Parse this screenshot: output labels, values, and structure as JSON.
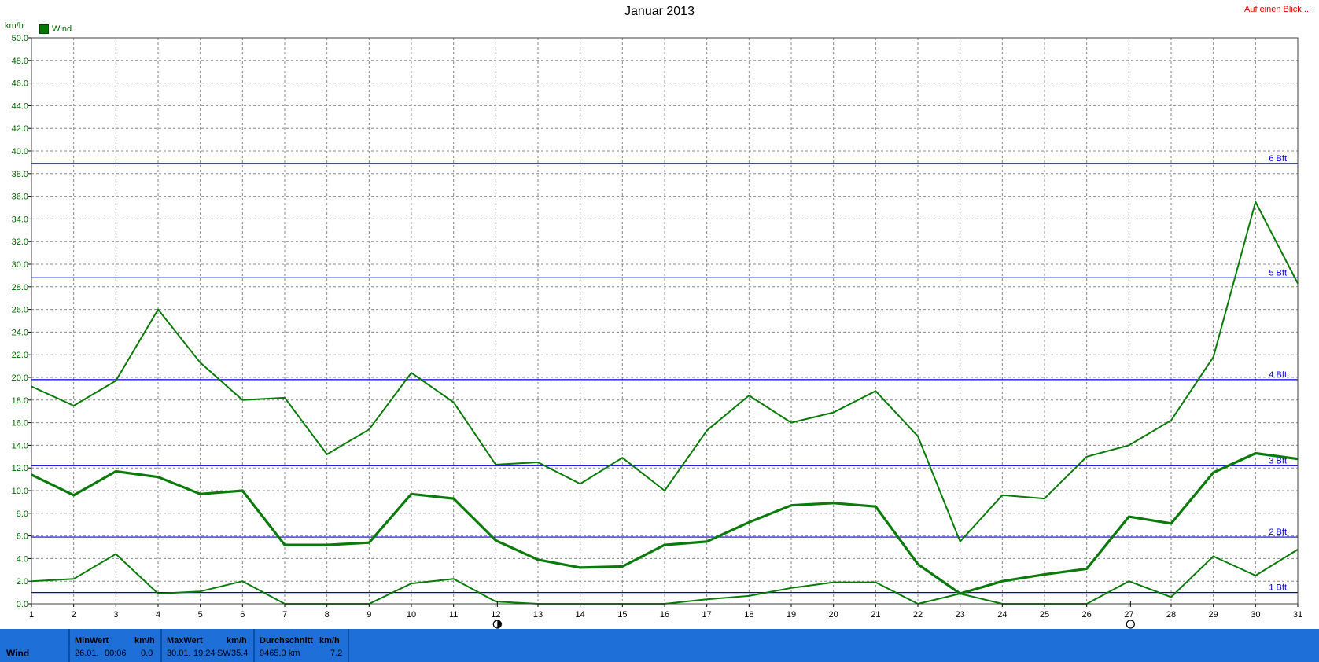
{
  "header": {
    "title": "Januar 2013",
    "glance_link": "Auf einen Blick ...",
    "unit": "km/h",
    "legend": "Wind"
  },
  "colors": {
    "series": "#0a7a0a",
    "beaufort": "#0000e0",
    "grid": "#8a8a8a",
    "stats_bar": "#1f6fd9"
  },
  "moon_icons": [
    "first-quarter-moon-icon",
    "full-moon-icon"
  ],
  "chart_data": {
    "type": "line",
    "title": "Januar 2013",
    "ylabel": "km/h",
    "ylim": [
      0,
      50
    ],
    "ytick_step": 2,
    "grid": true,
    "legend_position": "top-left",
    "x": [
      1,
      2,
      3,
      4,
      5,
      6,
      7,
      8,
      9,
      10,
      11,
      12,
      13,
      14,
      15,
      16,
      17,
      18,
      19,
      20,
      21,
      22,
      23,
      24,
      25,
      26,
      27,
      28,
      29,
      30,
      31
    ],
    "series": [
      {
        "name": "Wind",
        "role": "max",
        "values": [
          19.2,
          17.5,
          19.7,
          26.0,
          21.3,
          18.0,
          18.2,
          13.2,
          15.4,
          20.4,
          17.8,
          12.3,
          12.5,
          10.6,
          12.9,
          10.0,
          15.3,
          18.4,
          16.0,
          16.9,
          18.8,
          14.8,
          5.5,
          9.6,
          9.3,
          13.0,
          14.0,
          16.2,
          21.8,
          35.5,
          28.3
        ]
      },
      {
        "role": "average",
        "values": [
          11.4,
          9.6,
          11.7,
          11.2,
          9.7,
          10.0,
          5.2,
          5.2,
          5.4,
          9.7,
          9.3,
          5.6,
          3.9,
          3.2,
          3.3,
          5.2,
          5.5,
          7.2,
          8.7,
          8.9,
          8.6,
          3.5,
          0.9,
          2.0,
          2.6,
          3.1,
          7.7,
          7.1,
          11.6,
          13.3,
          12.8
        ]
      },
      {
        "role": "min",
        "values": [
          2.0,
          2.2,
          4.4,
          0.9,
          1.1,
          2.0,
          0.0,
          0.0,
          0.0,
          1.8,
          2.2,
          0.2,
          0.0,
          0.0,
          0.0,
          0.0,
          0.4,
          0.7,
          1.4,
          1.9,
          1.9,
          0.0,
          0.9,
          0.0,
          0.0,
          0.0,
          2.0,
          0.6,
          4.2,
          2.5,
          4.8
        ]
      }
    ],
    "reference_lines": [
      {
        "label": "1 Bft",
        "value": 1.0
      },
      {
        "label": "2 Bft",
        "value": 5.9
      },
      {
        "label": "3 Bft",
        "value": 12.2
      },
      {
        "label": "4 Bft",
        "value": 19.8
      },
      {
        "label": "5 Bft",
        "value": 28.8
      },
      {
        "label": "6 Bft",
        "value": 38.9
      }
    ],
    "moon_markers": [
      {
        "day": 12,
        "phase": "first-quarter"
      },
      {
        "day": 27,
        "phase": "full"
      }
    ]
  },
  "stats": {
    "series_name": "Wind",
    "min": {
      "header": "MinWert",
      "unit": "km/h",
      "date": "26.01.",
      "time": "00:06",
      "value": "0.0"
    },
    "max": {
      "header": "MaxWert",
      "unit": "km/h",
      "date": "30.01.",
      "time": "19:24",
      "dir": "SW",
      "value": "35.4"
    },
    "avg": {
      "header": "Durchschnitt",
      "unit": "km/h",
      "distance": "9465.0 km",
      "value": "7.2"
    }
  }
}
